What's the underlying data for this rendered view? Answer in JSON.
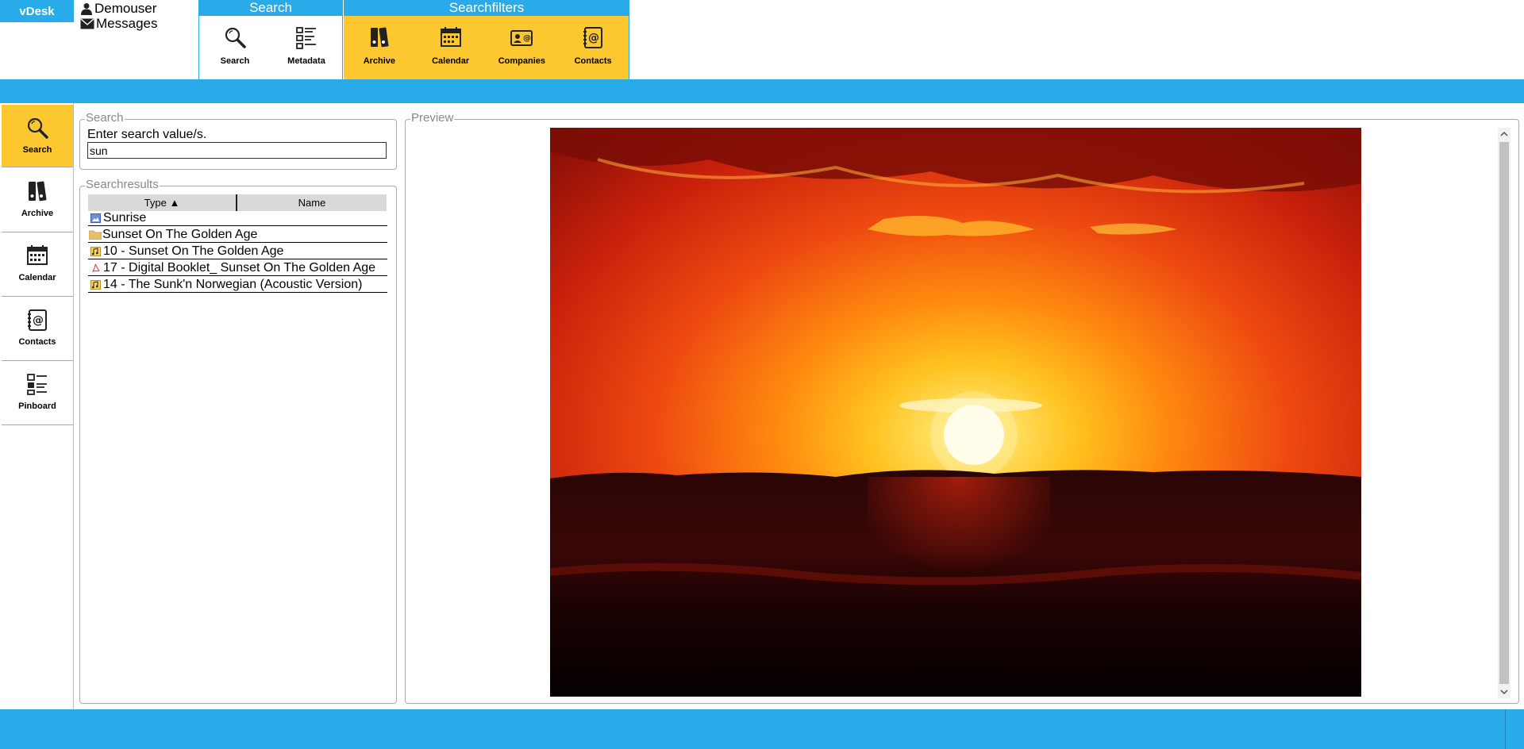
{
  "app": {
    "brand": "vDesk"
  },
  "user": {
    "name": "Demouser",
    "messages_label": "Messages"
  },
  "toolbar": {
    "search_group": {
      "title": "Search",
      "buttons": [
        {
          "label": "Search",
          "icon": "search-icon"
        },
        {
          "label": "Metadata",
          "icon": "metadata-icon"
        }
      ]
    },
    "filter_group": {
      "title": "Searchfilters",
      "buttons": [
        {
          "label": "Archive",
          "icon": "archive-icon"
        },
        {
          "label": "Calendar",
          "icon": "calendar-icon"
        },
        {
          "label": "Companies",
          "icon": "companies-icon"
        },
        {
          "label": "Contacts",
          "icon": "contacts-icon"
        }
      ]
    }
  },
  "nav": {
    "items": [
      {
        "label": "Search",
        "icon": "search-icon",
        "active": true
      },
      {
        "label": "Archive",
        "icon": "archive-icon"
      },
      {
        "label": "Calendar",
        "icon": "calendar-icon"
      },
      {
        "label": "Contacts",
        "icon": "contacts-icon"
      },
      {
        "label": "Pinboard",
        "icon": "pinboard-icon"
      }
    ]
  },
  "search": {
    "legend": "Search",
    "prompt": "Enter search value/s.",
    "value": "sun"
  },
  "results": {
    "legend": "Searchresults",
    "columns": [
      "Type ▲",
      "Name"
    ],
    "rows": [
      {
        "name": "Sunrise",
        "icon": "image-file-icon"
      },
      {
        "name": "Sunset On The Golden Age",
        "icon": "folder-icon"
      },
      {
        "name": "10 - Sunset On The Golden Age",
        "icon": "audio-file-icon"
      },
      {
        "name": "17 - Digital Booklet_ Sunset On The Golden Age",
        "icon": "pdf-file-icon"
      },
      {
        "name": "14 - The Sunk'n Norwegian (Acoustic Version)",
        "icon": "audio-file-icon"
      }
    ]
  },
  "preview": {
    "legend": "Preview"
  },
  "colors": {
    "accent_blue": "#29aae9",
    "accent_yellow": "#fdc82f"
  }
}
